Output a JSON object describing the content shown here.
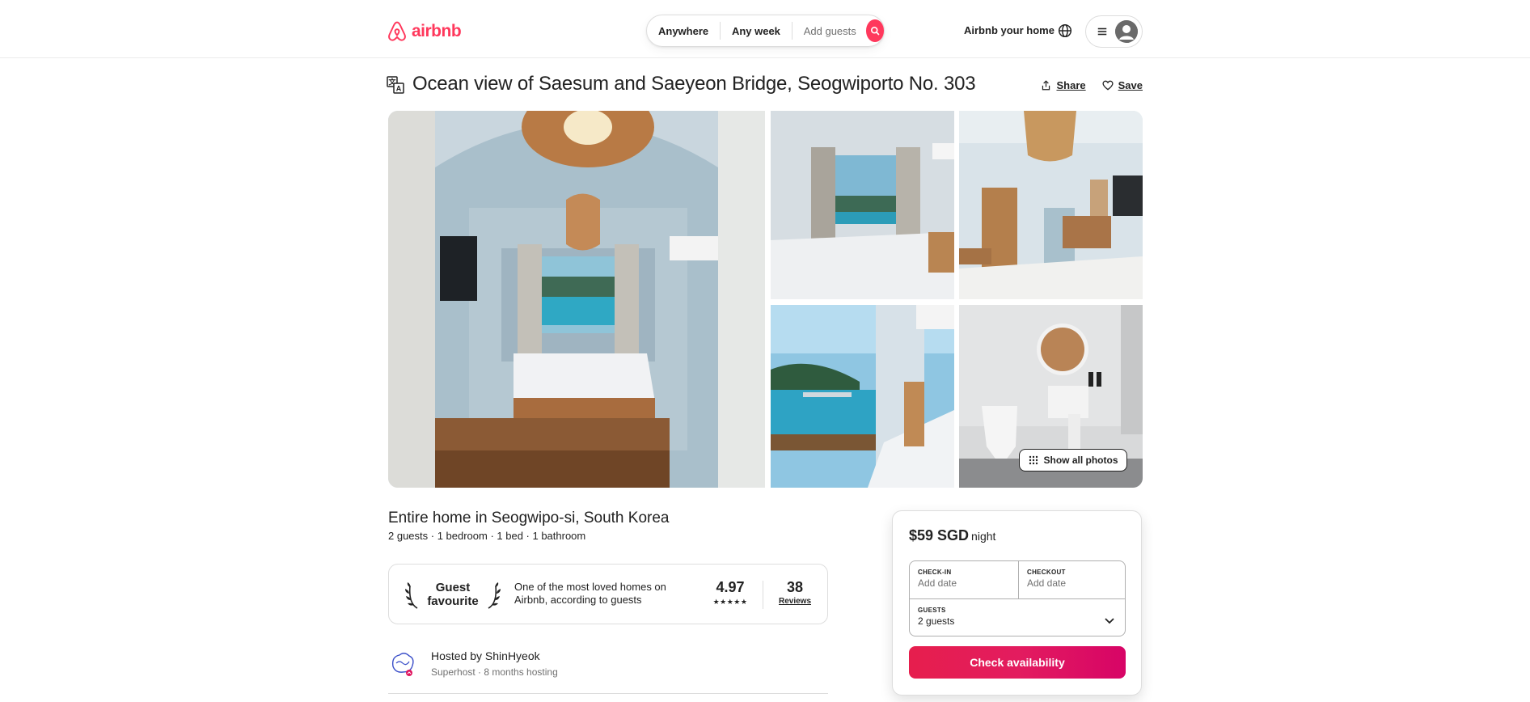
{
  "header": {
    "brand": "airbnb",
    "brand_color": "#ff385c",
    "search": {
      "location": "Anywhere",
      "dates": "Any week",
      "guests": "Add guests"
    },
    "host_link": "Airbnb your home"
  },
  "listing": {
    "title": "Ocean view of Saesum and Saeyeon Bridge, Seogwiporto No. 303",
    "share_label": "Share",
    "save_label": "Save",
    "show_all_photos": "Show all photos",
    "subtitle": "Entire home in Seogwipo-si, South Korea",
    "details": "2 guests · 1 bedroom · 1 bed · 1 bathroom"
  },
  "guest_favourite": {
    "badge": "Guest favourite",
    "description": "One of the most loved homes on Airbnb, according to guests",
    "rating": "4.97",
    "stars": "★★★★★",
    "reviews_count": "38",
    "reviews_label": "Reviews"
  },
  "host": {
    "name": "Hosted by ShinHyeok",
    "meta": "Superhost · 8 months hosting"
  },
  "booking": {
    "price": "$59 SGD",
    "price_unit": "night",
    "checkin_label": "CHECK-IN",
    "checkin_value": "Add date",
    "checkout_label": "CHECKOUT",
    "checkout_value": "Add date",
    "guests_label": "GUESTS",
    "guests_value": "2 guests",
    "button": "Check availability",
    "button_color": "#e31c5f"
  }
}
